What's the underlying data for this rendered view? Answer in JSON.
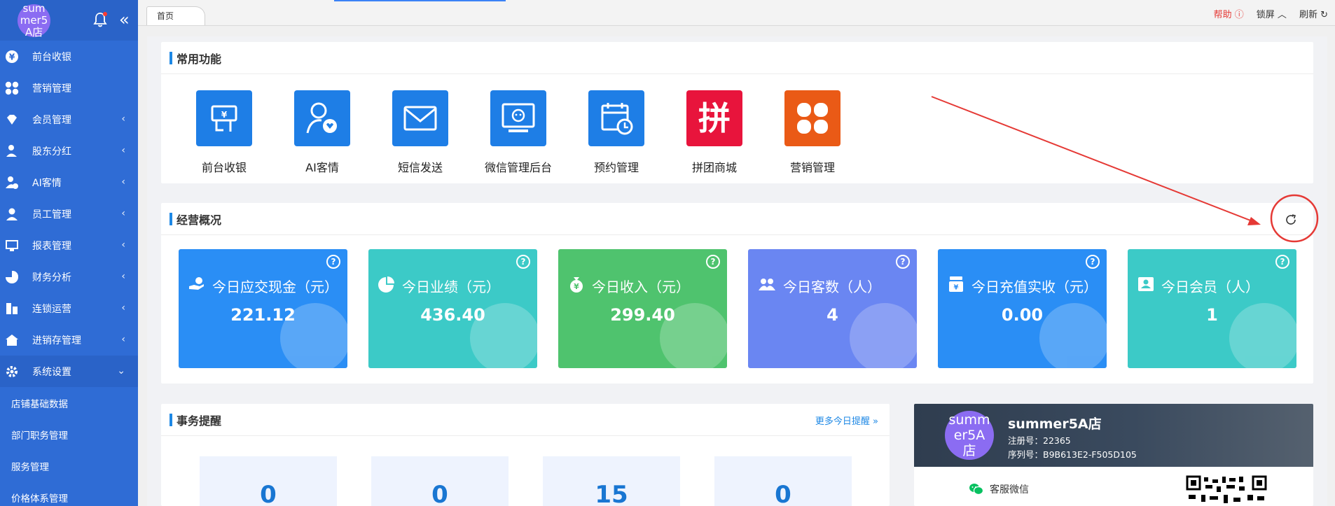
{
  "sidebar": {
    "store_avatar": "summer5A店",
    "items": [
      {
        "label": "前台收银",
        "chevron": false
      },
      {
        "label": "营销管理",
        "chevron": false
      },
      {
        "label": "会员管理",
        "chevron": true
      },
      {
        "label": "股东分红",
        "chevron": true
      },
      {
        "label": "AI客情",
        "chevron": true
      },
      {
        "label": "员工管理",
        "chevron": true
      },
      {
        "label": "报表管理",
        "chevron": true
      },
      {
        "label": "财务分析",
        "chevron": true
      },
      {
        "label": "连锁运营",
        "chevron": true
      },
      {
        "label": "进销存管理",
        "chevron": true
      },
      {
        "label": "系统设置",
        "chevron": true
      }
    ],
    "sub_items": [
      "店铺基础数据",
      "部门职务管理",
      "服务管理",
      "价格体系管理"
    ]
  },
  "topbar": {
    "tab": "首页",
    "help": "帮助",
    "lock": "锁屏",
    "refresh": "刷新"
  },
  "quick": {
    "title": "常用功能",
    "items": [
      {
        "label": "前台收银",
        "color": "#1e7ee6",
        "icon": "cashier-icon"
      },
      {
        "label": "AI客情",
        "color": "#1e7ee6",
        "icon": "ai-customer-icon"
      },
      {
        "label": "短信发送",
        "color": "#1e7ee6",
        "icon": "mail-icon"
      },
      {
        "label": "微信管理后台",
        "color": "#1e7ee6",
        "icon": "wechat-monitor-icon"
      },
      {
        "label": "预约管理",
        "color": "#1e7ee6",
        "icon": "calendar-clock-icon"
      },
      {
        "label": "拼团商城",
        "color": "#e8143c",
        "icon": "pin-icon",
        "glyph": "拼"
      },
      {
        "label": "营销管理",
        "color": "#ea5a16",
        "icon": "clover-icon"
      }
    ]
  },
  "overview": {
    "title": "经营概况",
    "cards": [
      {
        "title": "今日应交现金（元）",
        "value": "221.12",
        "color": "#2a8ef5",
        "icon": "cash-hand-icon"
      },
      {
        "title": "今日业绩（元）",
        "value": "436.40",
        "color": "#3ccac7",
        "icon": "pie-icon"
      },
      {
        "title": "今日收入（元）",
        "value": "299.40",
        "color": "#4fc36e",
        "icon": "money-bag-icon"
      },
      {
        "title": "今日客数（人）",
        "value": "4",
        "color": "#6a86f2",
        "icon": "people-icon"
      },
      {
        "title": "今日充值实收（元）",
        "value": "0.00",
        "color": "#2a8ef5",
        "icon": "recharge-icon"
      },
      {
        "title": "今日会员（人）",
        "value": "1",
        "color": "#3ccac7",
        "icon": "member-icon"
      }
    ]
  },
  "tasks": {
    "title": "事务提醒",
    "more": "更多今日提醒",
    "values": [
      "0",
      "0",
      "15",
      "0"
    ]
  },
  "store": {
    "avatar": "summer5A店",
    "name": "summer5A店",
    "reg": "注册号：22365",
    "serial": "序列号：B9B613E2-F505D105",
    "service": "客服微信"
  }
}
